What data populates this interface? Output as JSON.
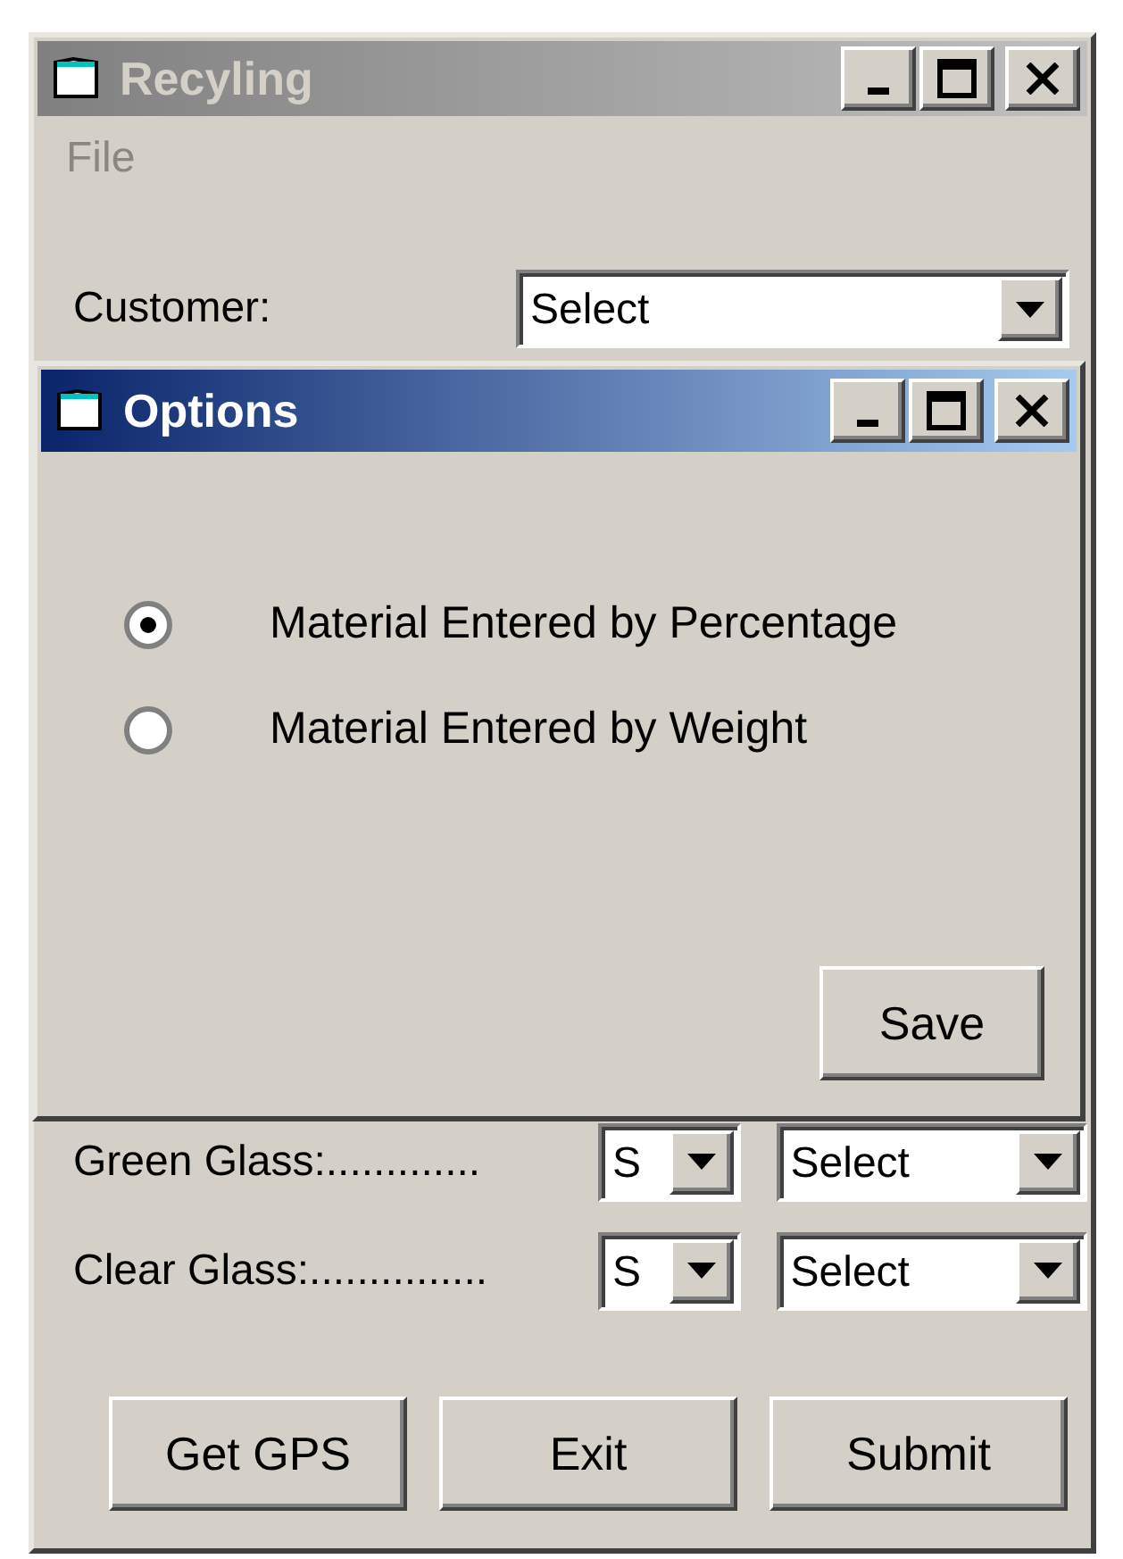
{
  "main_window": {
    "title": "Recyling",
    "active": false,
    "menu": [
      "File"
    ],
    "customer": {
      "label": "Customer:",
      "value": "Select"
    },
    "rows": [
      {
        "label": "Green Glass:.............",
        "unit": "S",
        "value": "Select"
      },
      {
        "label": "Clear Glass:...............",
        "unit": "S",
        "value": "Select"
      }
    ],
    "buttons": [
      "Get GPS",
      "Exit",
      "Submit"
    ]
  },
  "options_dialog": {
    "title": "Options",
    "active": true,
    "radios": [
      {
        "label": "Material Entered by Percentage",
        "selected": true
      },
      {
        "label": "Material Entered by Weight",
        "selected": false
      }
    ],
    "buttons": [
      "Save"
    ]
  }
}
